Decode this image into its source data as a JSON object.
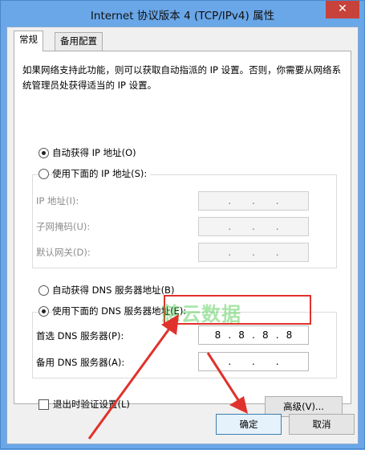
{
  "window": {
    "title": "Internet 协议版本 4 (TCP/IPv4) 属性",
    "close_label": "✕"
  },
  "tabs": [
    {
      "label": "常规",
      "active": true
    },
    {
      "label": "备用配置",
      "active": false
    }
  ],
  "description": "如果网络支持此功能，则可以获取自动指派的 IP 设置。否则，你需要从网络系统管理员处获得适当的 IP 设置。",
  "ip": {
    "auto_label": "自动获得 IP 地址(O)",
    "auto_checked": true,
    "manual_label": "使用下面的 IP 地址(S):",
    "manual_checked": false,
    "fields": [
      {
        "label": "IP 地址(I):",
        "value": [
          "",
          "",
          "",
          ""
        ]
      },
      {
        "label": "子网掩码(U):",
        "value": [
          "",
          "",
          "",
          ""
        ]
      },
      {
        "label": "默认网关(D):",
        "value": [
          "",
          "",
          "",
          ""
        ]
      }
    ]
  },
  "dns": {
    "auto_label": "自动获得 DNS 服务器地址(B)",
    "auto_checked": false,
    "manual_label": "使用下面的 DNS 服务器地址(E):",
    "manual_checked": true,
    "preferred_label": "首选 DNS 服务器(P):",
    "preferred_value": [
      "8",
      "8",
      "8",
      "8"
    ],
    "alternate_label": "备用 DNS 服务器(A):",
    "alternate_value": [
      "",
      "",
      "",
      ""
    ]
  },
  "validate_label": "退出时验证设置(L)",
  "validate_checked": false,
  "buttons": {
    "advanced": "高级(V)...",
    "ok": "确定",
    "cancel": "取消"
  },
  "watermark": "慈云数据",
  "colors": {
    "titlebar": "#6aa7e8",
    "close": "#c7423a",
    "highlight": "#e0322c",
    "watermark": "#3cc83c"
  }
}
